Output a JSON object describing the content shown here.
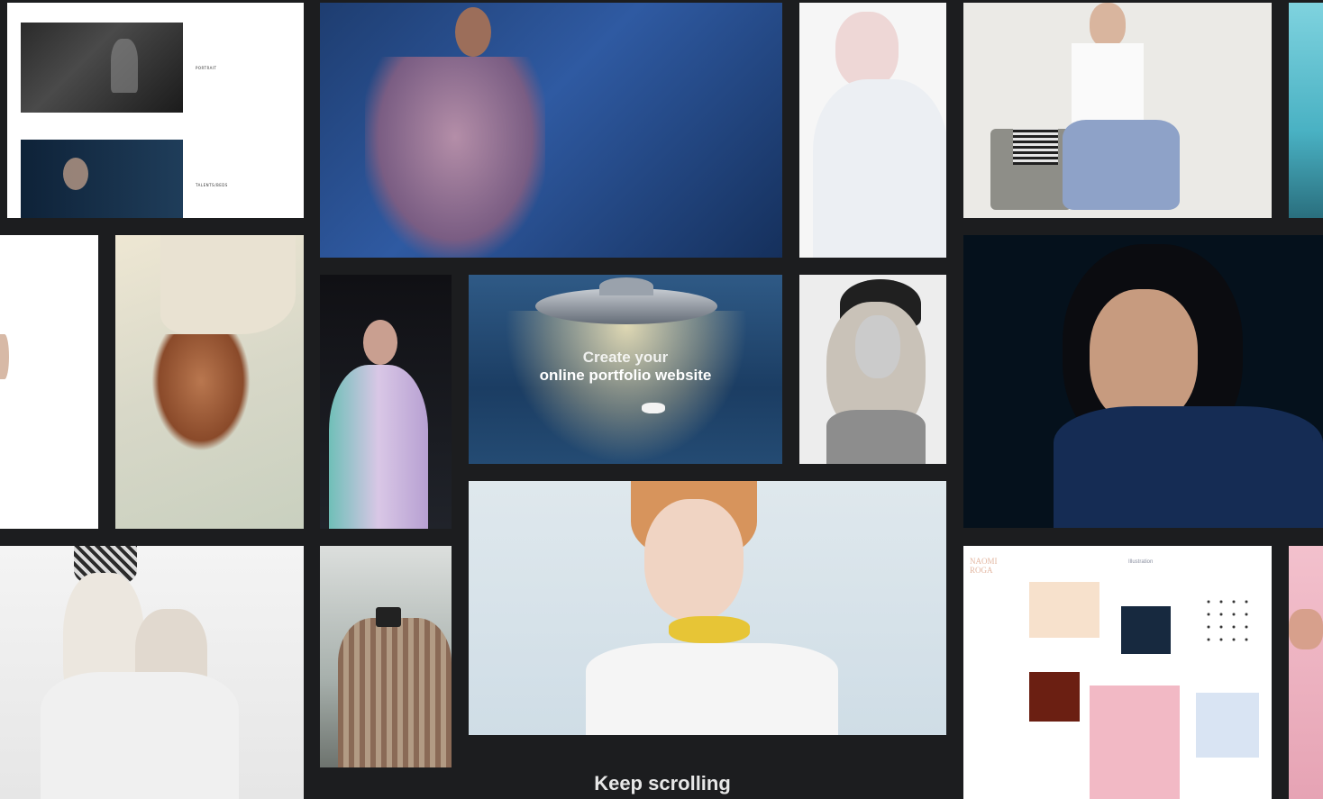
{
  "portfolio_sample": {
    "item_1_label": "PORTRAIT",
    "item_2_label": "TALENTS/BEDS"
  },
  "hero": {
    "line1": "Create your",
    "line2": "online portfolio website"
  },
  "illustration": {
    "artist_name": "NAOMI ROGA",
    "section_title": "Illustration"
  },
  "scroll_hint": "Keep scrolling",
  "colors": {
    "background": "#1c1d1f",
    "hero_overlay": "#18375e"
  }
}
